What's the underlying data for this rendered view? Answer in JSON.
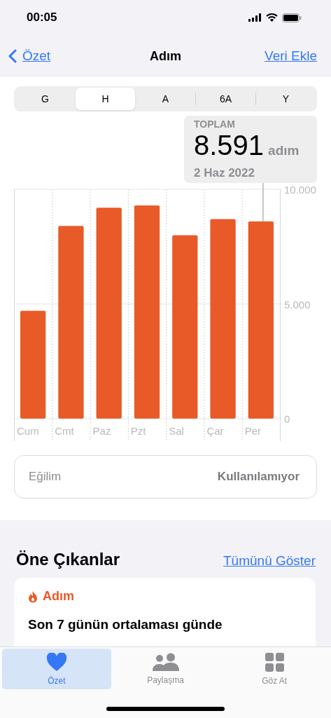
{
  "status_bar": {
    "time": "00:05"
  },
  "nav": {
    "back": "Özet",
    "title": "Adım",
    "action": "Veri Ekle"
  },
  "segments": [
    {
      "label": "G",
      "selected": false
    },
    {
      "label": "H",
      "selected": true
    },
    {
      "label": "A",
      "selected": false
    },
    {
      "label": "6A",
      "selected": false
    },
    {
      "label": "Y",
      "selected": false
    }
  ],
  "summary": {
    "label": "TOPLAM",
    "value": "8.591",
    "unit": "adım",
    "date": "2 Haz 2022"
  },
  "chart": {
    "chart_data": {
      "type": "bar",
      "categories": [
        "Cum",
        "Cmt",
        "Paz",
        "Pzt",
        "Sal",
        "Çar",
        "Per"
      ],
      "values": [
        4700,
        8400,
        9200,
        9300,
        8000,
        8700,
        8600
      ],
      "ylim": [
        0,
        10000
      ],
      "yticks": [
        {
          "value": 0,
          "label": "0"
        },
        {
          "value": 5000,
          "label": "5.000"
        },
        {
          "value": 10000,
          "label": "10.000"
        }
      ]
    }
  },
  "trend": {
    "label": "Eğilim",
    "value": "Kullanılamıyor"
  },
  "highlights": {
    "title": "Öne Çıkanlar",
    "link": "Tümünü Göster",
    "card": {
      "category": "Adım",
      "text": "Son 7 günün ortalaması günde"
    }
  },
  "tab_bar": [
    {
      "label": "Özet",
      "kind": "heart",
      "selected": true
    },
    {
      "label": "Paylaşma",
      "kind": "people",
      "selected": false
    },
    {
      "label": "Göz At",
      "kind": "grid",
      "selected": false
    }
  ]
}
